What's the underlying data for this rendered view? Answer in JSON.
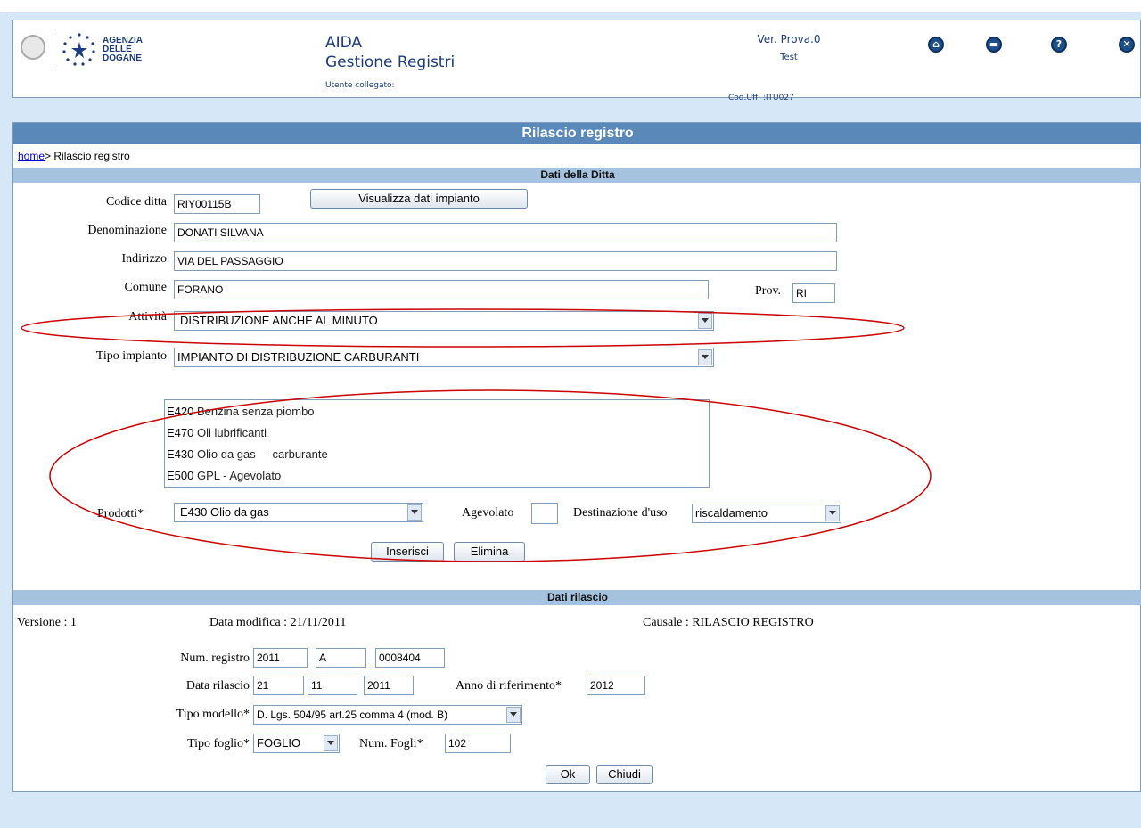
{
  "header": {
    "agency_name": "AGENZIA\nDELLE\nDOGANE",
    "app_title": "AIDA",
    "app_subtitle": "Gestione Registri",
    "user_label": "Utente collegato:",
    "version": "Ver. Prova.0",
    "environment": "Test",
    "office_code": "Cod.Uff. :ITU027",
    "icons": [
      "home-icon",
      "print-icon",
      "help-icon",
      "exit-icon"
    ]
  },
  "page": {
    "title": "Rilascio registro",
    "breadcrumb_home": "home",
    "breadcrumb_current": "> Rilascio registro"
  },
  "ditta": {
    "section_title": "Dati della Ditta",
    "codice_label": "Codice ditta",
    "codice_value": "RIY00115B",
    "visualizza_button": "Visualizza dati impianto",
    "denominazione_label": "Denominazione",
    "denominazione_value": "DONATI SILVANA",
    "indirizzo_label": "Indirizzo",
    "indirizzo_value": "VIA DEL PASSAGGIO",
    "comune_label": "Comune",
    "comune_value": "FORANO",
    "prov_label": "Prov.",
    "prov_value": "RI",
    "attivita_label": "Attività",
    "attivita_value": "DISTRIBUZIONE ANCHE AL MINUTO",
    "tipo_impianto_label": "Tipo impianto",
    "tipo_impianto_value": "IMPIANTO DI DISTRIBUZIONE CARBURANTI",
    "prodotti_list": [
      {
        "code": "E420",
        "desc": "Benzina senza piombo"
      },
      {
        "code": "E470",
        "desc": "Oli lubrificanti"
      },
      {
        "code": "E430",
        "desc": "Olio da gas   - carburante"
      },
      {
        "code": "E500",
        "desc": "GPL - Agevolato"
      }
    ],
    "prodotti_label": "Prodotti*",
    "prodotti_value": "E430 Olio da gas",
    "agevolato_label": "Agevolato",
    "agevolato_value": "",
    "destinazione_label": "Destinazione d'uso",
    "destinazione_value": "riscaldamento",
    "inserisci_button": "Inserisci",
    "elimina_button": "Elimina"
  },
  "rilascio": {
    "section_title": "Dati rilascio",
    "versione": "Versione : 1",
    "data_modifica": "Data modifica : 21/11/2011",
    "causale": "Causale : RILASCIO REGISTRO",
    "num_registro_label": "Num. registro",
    "num_registro_anno": "2011",
    "num_registro_serie": "A",
    "num_registro_numero": "0008404",
    "data_rilascio_label": "Data rilascio",
    "data_giorno": "21",
    "data_mese": "11",
    "data_anno": "2011",
    "anno_rif_label": "Anno di riferimento*",
    "anno_rif_value": "2012",
    "tipo_modello_label": "Tipo modello*",
    "tipo_modello_value": "D. Lgs. 504/95 art.25 comma 4 (mod. B)",
    "tipo_foglio_label": "Tipo foglio*",
    "tipo_foglio_value": "FOGLIO",
    "num_fogli_label": "Num. Fogli*",
    "num_fogli_value": "102",
    "ok_button": "Ok",
    "chiudi_button": "Chiudi"
  },
  "colors": {
    "background": "#d6e8f8",
    "title_bar": "#5a88b8",
    "section_bar": "#a5c3de",
    "annotation_red": "#cc0000"
  }
}
